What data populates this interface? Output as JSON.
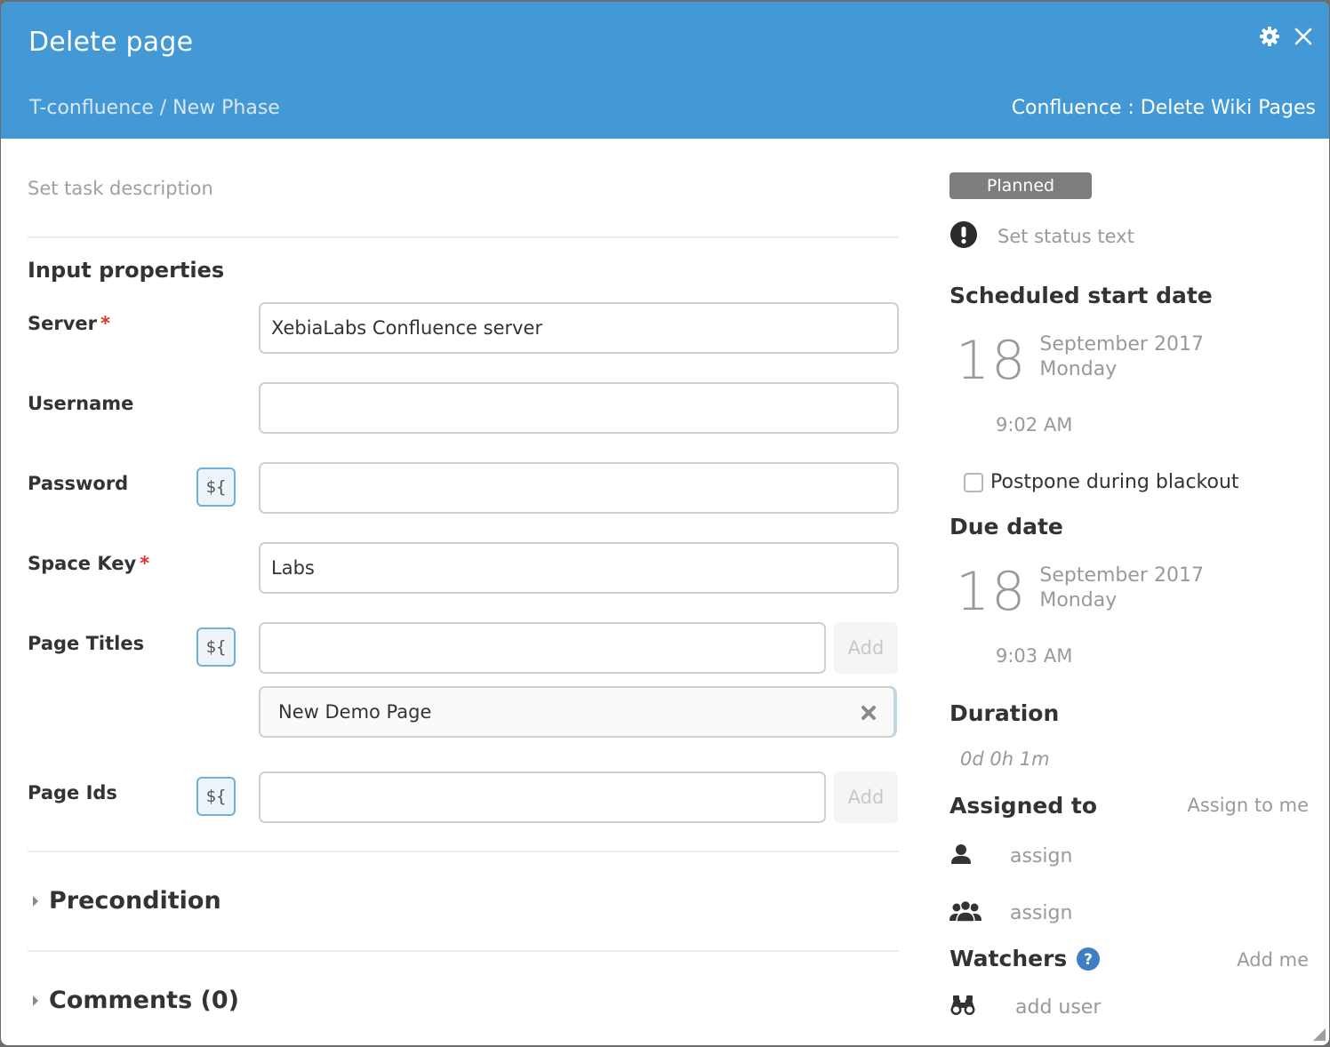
{
  "header": {
    "title": "Delete page",
    "breadcrumb": "T-confluence / New Phase",
    "task_type": "Confluence : Delete Wiki Pages",
    "icons": [
      "gear-icon",
      "close-icon"
    ],
    "background_color": "#4399d5"
  },
  "description": {
    "placeholder": "Set task description"
  },
  "input_properties": {
    "title": "Input properties",
    "fields": [
      {
        "label": "Server",
        "required": true,
        "variable_toggle": false,
        "value": "XebiaLabs Confluence server"
      },
      {
        "label": "Username",
        "required": false,
        "variable_toggle": false,
        "value": ""
      },
      {
        "label": "Password",
        "required": false,
        "variable_toggle": true,
        "value": ""
      },
      {
        "label": "Space Key",
        "required": true,
        "variable_toggle": false,
        "value": "Labs"
      },
      {
        "label": "Page Titles",
        "required": false,
        "variable_toggle": true,
        "value": "",
        "add_label": "Add",
        "items": [
          "New Demo Page"
        ]
      },
      {
        "label": "Page Ids",
        "required": false,
        "variable_toggle": true,
        "value": "",
        "add_label": "Add",
        "items": []
      }
    ],
    "variable_button_label": "${",
    "required_marker": "*"
  },
  "sections": {
    "precondition": "Precondition",
    "comments": "Comments (0)"
  },
  "sidebar": {
    "status_badge": "Planned",
    "status_text_placeholder": "Set status text",
    "scheduled_start": {
      "title": "Scheduled start date",
      "day": "18",
      "month_year": "September 2017",
      "weekday": "Monday",
      "time": "9:02 AM"
    },
    "postpone_blackout": {
      "label": "Postpone during blackout",
      "checked": false
    },
    "due_date": {
      "title": "Due date",
      "day": "18",
      "month_year": "September 2017",
      "weekday": "Monday",
      "time": "9:03 AM"
    },
    "duration": {
      "title": "Duration",
      "value": "0d 0h 1m"
    },
    "assigned_to": {
      "title": "Assigned to",
      "assign_to_me": "Assign to me",
      "user_placeholder": "assign",
      "team_placeholder": "assign"
    },
    "watchers": {
      "title": "Watchers",
      "add_me": "Add me",
      "add_user_placeholder": "add user"
    }
  }
}
